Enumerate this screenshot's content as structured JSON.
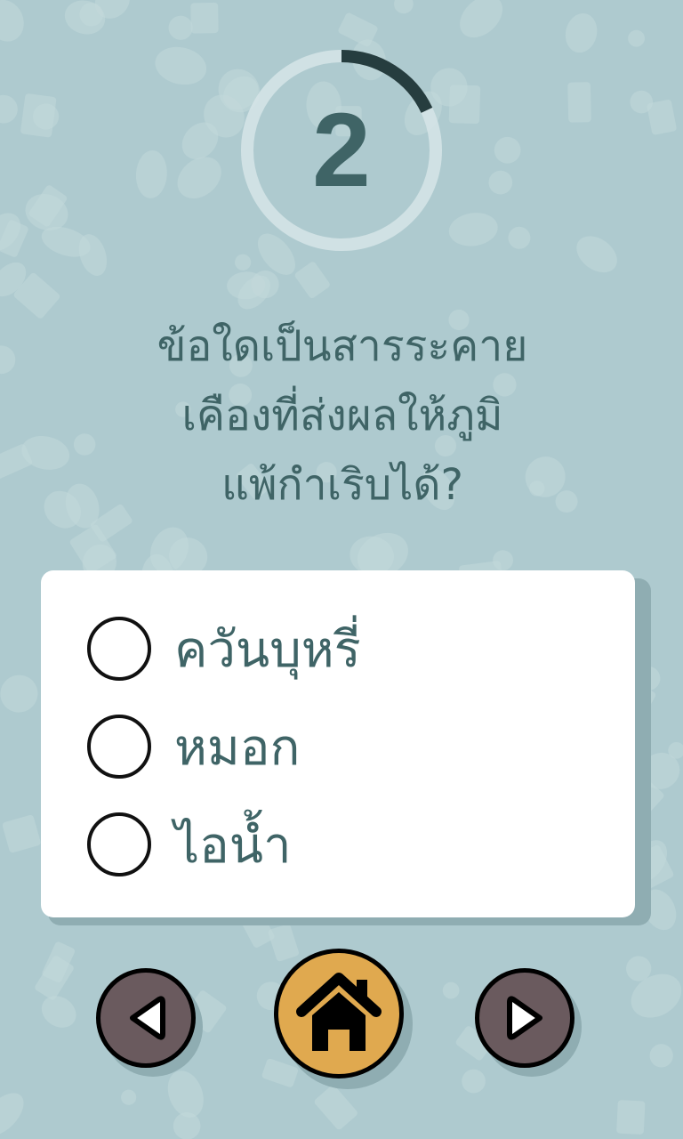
{
  "timer": {
    "value": "2",
    "progress": 0.18
  },
  "question": {
    "lines": [
      "ข้อใดเป็นสารระคาย",
      "เคืองที่ส่งผลให้ภูมิ",
      "แพ้กำเริบได้?"
    ]
  },
  "answers": [
    {
      "label": "ควันบุหรี่"
    },
    {
      "label": "หมอก"
    },
    {
      "label": "ไอน้ำ"
    }
  ],
  "navigation": {
    "prev_icon": "triangle-left-icon",
    "home_icon": "house-icon",
    "next_icon": "triangle-right-icon"
  },
  "colors": {
    "background": "#aecacf",
    "text": "#3f6466",
    "timer_arc": "#263d3f",
    "home_button": "#e0a94f",
    "arrow_button": "#6a5a5e"
  }
}
